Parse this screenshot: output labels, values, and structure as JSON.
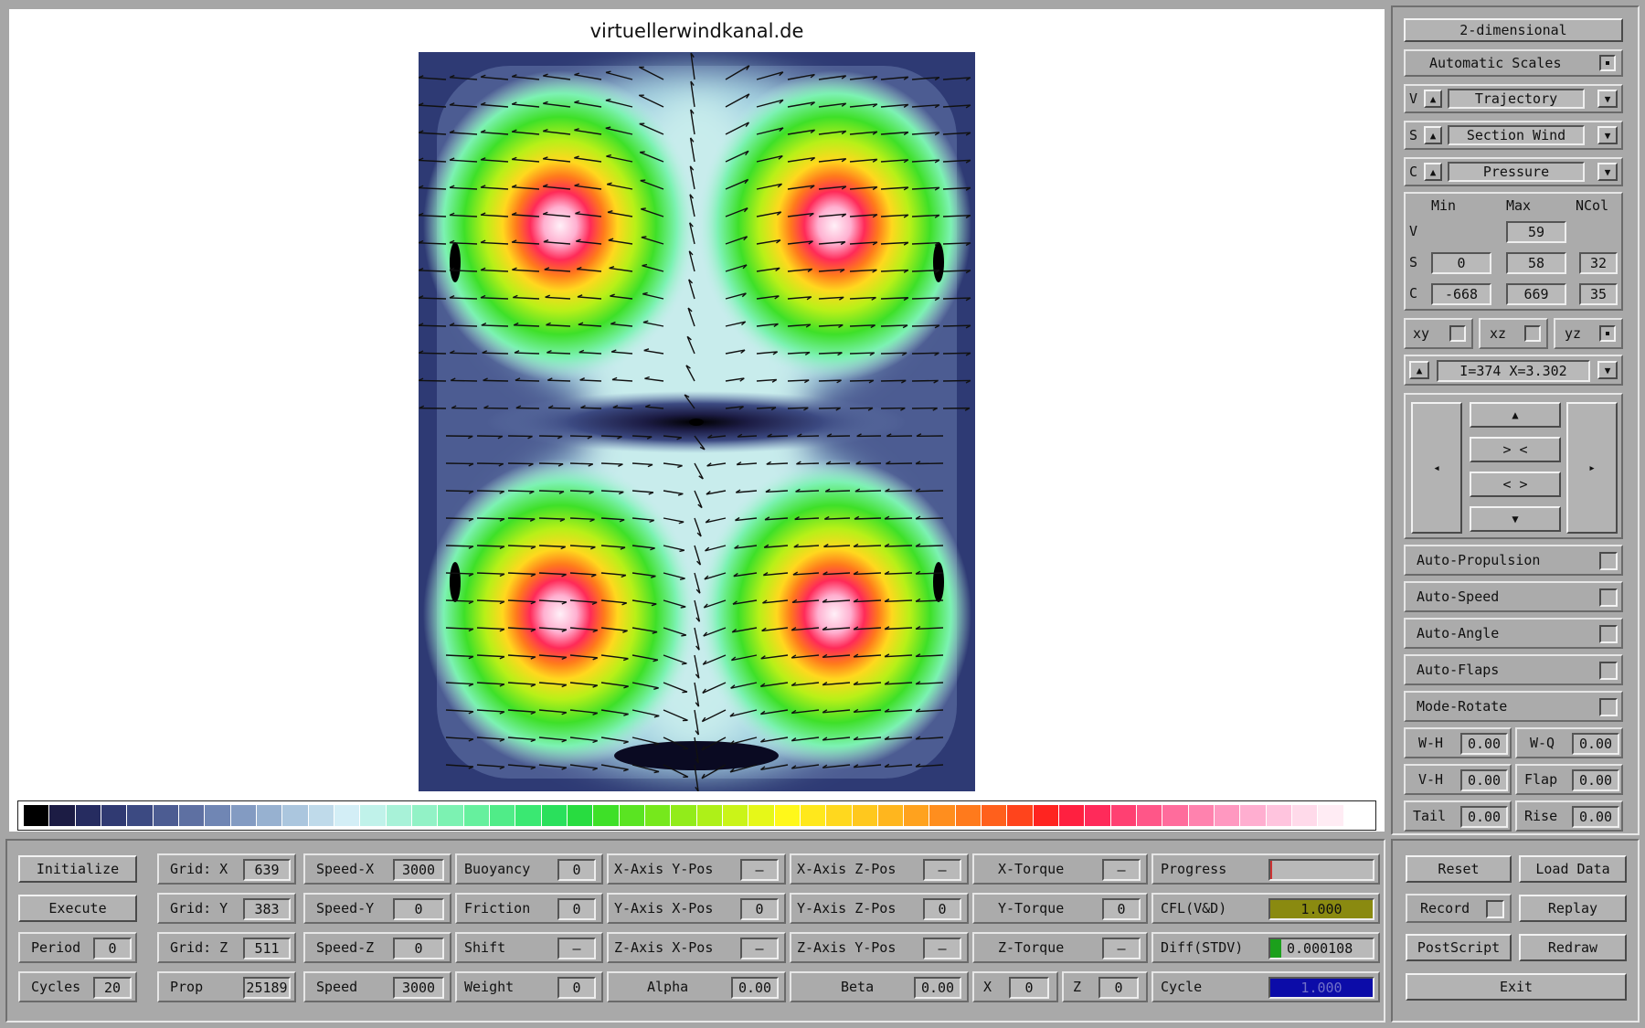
{
  "title": "virtuellerwindkanal.de",
  "colors": {
    "panel": "#a9a9a9",
    "cfl_fill": "#8a8a10",
    "diff_fill": "#1ca01c",
    "cycle_fill": "#0c0ca8",
    "progress_mark": "#cc3333"
  },
  "colorbar": {
    "colors": [
      "#000000",
      "#1c1c44",
      "#262c60",
      "#303a72",
      "#3c4a82",
      "#4c5c92",
      "#5e70a2",
      "#7086b4",
      "#839bc2",
      "#97b1d0",
      "#abc6de",
      "#bfdaea",
      "#d3eef6",
      "#c0f2ea",
      "#a8f2d8",
      "#92f2c6",
      "#7cf2b2",
      "#66f09e",
      "#50ec88",
      "#3ae872",
      "#2ae05c",
      "#28dc40",
      "#3ee028",
      "#5ae422",
      "#76e81c",
      "#92ec1a",
      "#aef018",
      "#caf418",
      "#e6f818",
      "#fff81a",
      "#ffe81c",
      "#ffd81e",
      "#ffc81e",
      "#ffb61e",
      "#ffa21e",
      "#ff8e1e",
      "#ff7a1c",
      "#ff601c",
      "#ff441c",
      "#ff2420",
      "#ff2040",
      "#ff2a5a",
      "#ff4072",
      "#ff5688",
      "#ff6c9c",
      "#ff82ae",
      "#ff98c0",
      "#ffaed0",
      "#ffc4de",
      "#ffdaea",
      "#ffecf4",
      "#ffffff"
    ]
  },
  "side": {
    "mode_button": "2-dimensional",
    "auto_scales": {
      "label": "Automatic Scales",
      "checked": true
    },
    "selectors": [
      {
        "key": "V",
        "value": "Trajectory"
      },
      {
        "key": "S",
        "value": "Section Wind"
      },
      {
        "key": "C",
        "value": "Pressure"
      }
    ],
    "ranges": {
      "headers": [
        "Min",
        "Max",
        "NCol"
      ],
      "rows": [
        {
          "key": "V",
          "min": "",
          "max": "59",
          "ncol": ""
        },
        {
          "key": "S",
          "min": "0",
          "max": "58",
          "ncol": "32"
        },
        {
          "key": "C",
          "min": "-668",
          "max": "669",
          "ncol": "35"
        }
      ]
    },
    "planes": [
      {
        "label": "xy",
        "checked": false
      },
      {
        "label": "xz",
        "checked": false
      },
      {
        "label": "yz",
        "checked": true
      }
    ],
    "slice": "I=374  X=3.302",
    "nav": {
      "up": "▲",
      "down": "▼",
      "left": "◂",
      "right": "▸",
      "zoom_in": "> <",
      "zoom_out": "< >"
    },
    "toggles": [
      "Auto-Propulsion",
      "Auto-Speed",
      "Auto-Angle",
      "Auto-Flaps",
      "Mode-Rotate"
    ],
    "params": [
      {
        "label": "W-H",
        "value": "0.00"
      },
      {
        "label": "W-Q",
        "value": "0.00"
      },
      {
        "label": "V-H",
        "value": "0.00"
      },
      {
        "label": "Flap",
        "value": "0.00"
      },
      {
        "label": "Tail",
        "value": "0.00"
      },
      {
        "label": "Rise",
        "value": "0.00"
      }
    ]
  },
  "bottom": {
    "initialize": "Initialize",
    "execute": "Execute",
    "period": {
      "label": "Period",
      "value": "0"
    },
    "cycles": {
      "label": "Cycles",
      "value": "20"
    },
    "grid_x": {
      "label": "Grid: X",
      "value": "639"
    },
    "grid_y": {
      "label": "Grid: Y",
      "value": "383"
    },
    "grid_z": {
      "label": "Grid: Z",
      "value": "511"
    },
    "prop": {
      "label": "Prop",
      "value": "25189"
    },
    "speed_x": {
      "label": "Speed-X",
      "value": "3000"
    },
    "speed_y": {
      "label": "Speed-Y",
      "value": "0"
    },
    "speed_z": {
      "label": "Speed-Z",
      "value": "0"
    },
    "speed": {
      "label": "Speed",
      "value": "3000"
    },
    "buoyancy": {
      "label": "Buoyancy",
      "value": "0"
    },
    "friction": {
      "label": "Friction",
      "value": "0"
    },
    "shift": {
      "label": "Shift",
      "value": "—"
    },
    "weight": {
      "label": "Weight",
      "value": "0"
    },
    "xaxis_ypos": {
      "label": "X-Axis Y-Pos",
      "value": "—"
    },
    "yaxis_xpos": {
      "label": "Y-Axis X-Pos",
      "value": "0"
    },
    "zaxis_xpos": {
      "label": "Z-Axis X-Pos",
      "value": "—"
    },
    "alpha": {
      "label": "Alpha",
      "value": "0.00"
    },
    "xaxis_zpos": {
      "label": "X-Axis Z-Pos",
      "value": "—"
    },
    "yaxis_zpos": {
      "label": "Y-Axis Z-Pos",
      "value": "0"
    },
    "zaxis_ypos": {
      "label": "Z-Axis Y-Pos",
      "value": "—"
    },
    "beta": {
      "label": "Beta",
      "value": "0.00"
    },
    "x_torque": {
      "label": "X-Torque",
      "value": "—"
    },
    "y_torque": {
      "label": "Y-Torque",
      "value": "0"
    },
    "z_torque": {
      "label": "Z-Torque",
      "value": "—"
    },
    "x": {
      "label": "X",
      "value": "0"
    },
    "z": {
      "label": "Z",
      "value": "0"
    },
    "progress": {
      "label": "Progress",
      "fraction": 0.0
    },
    "cfl": {
      "label": "CFL(V&D)",
      "value": "1.000"
    },
    "diff": {
      "label": "Diff(STDV)",
      "value": "0.000108"
    },
    "cycle": {
      "label": "Cycle",
      "value": "1.000"
    },
    "reset": "Reset",
    "load_data": "Load Data",
    "record": "Record",
    "replay": "Replay",
    "postscript": "PostScript",
    "redraw": "Redraw",
    "exit": "Exit"
  }
}
